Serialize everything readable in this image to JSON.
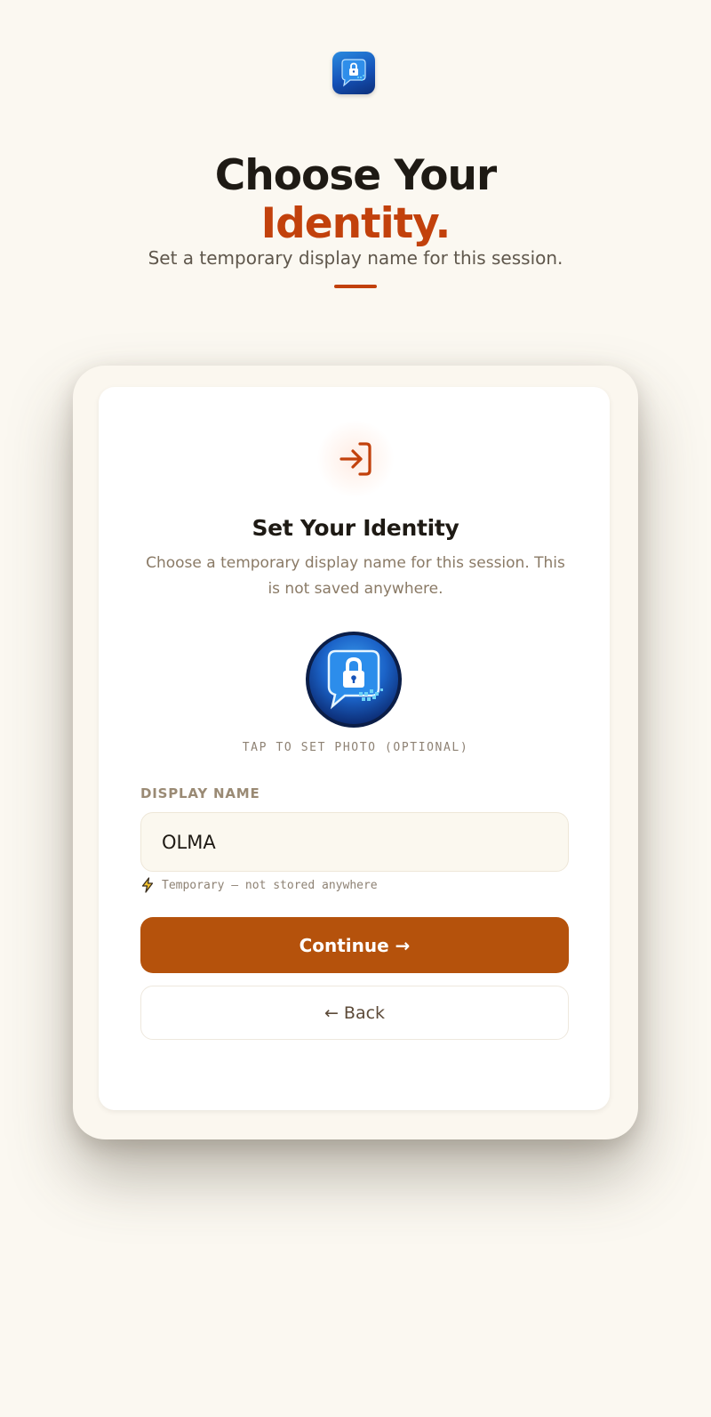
{
  "header": {
    "logo_icon": "chat-lock-icon",
    "title_line1": "Choose Your",
    "title_line2": "Identity.",
    "subtitle": "Set a temporary display name for this session.",
    "accent_color": "#C2410C"
  },
  "card": {
    "icon": "sign-in-icon",
    "title": "Set Your Identity",
    "description": "Choose a temporary display name for this session. This is not saved anywhere.",
    "avatar_icon": "chat-lock-icon",
    "photo_hint": "TAP TO SET PHOTO (OPTIONAL)",
    "display_name_label": "DISPLAY NAME",
    "display_name_value": "OLMA",
    "hint_icon": "lightning-icon",
    "hint_text": "Temporary — not stored anywhere",
    "continue_label": "Continue →",
    "back_label": "← Back",
    "button_color": "#B5520C"
  }
}
